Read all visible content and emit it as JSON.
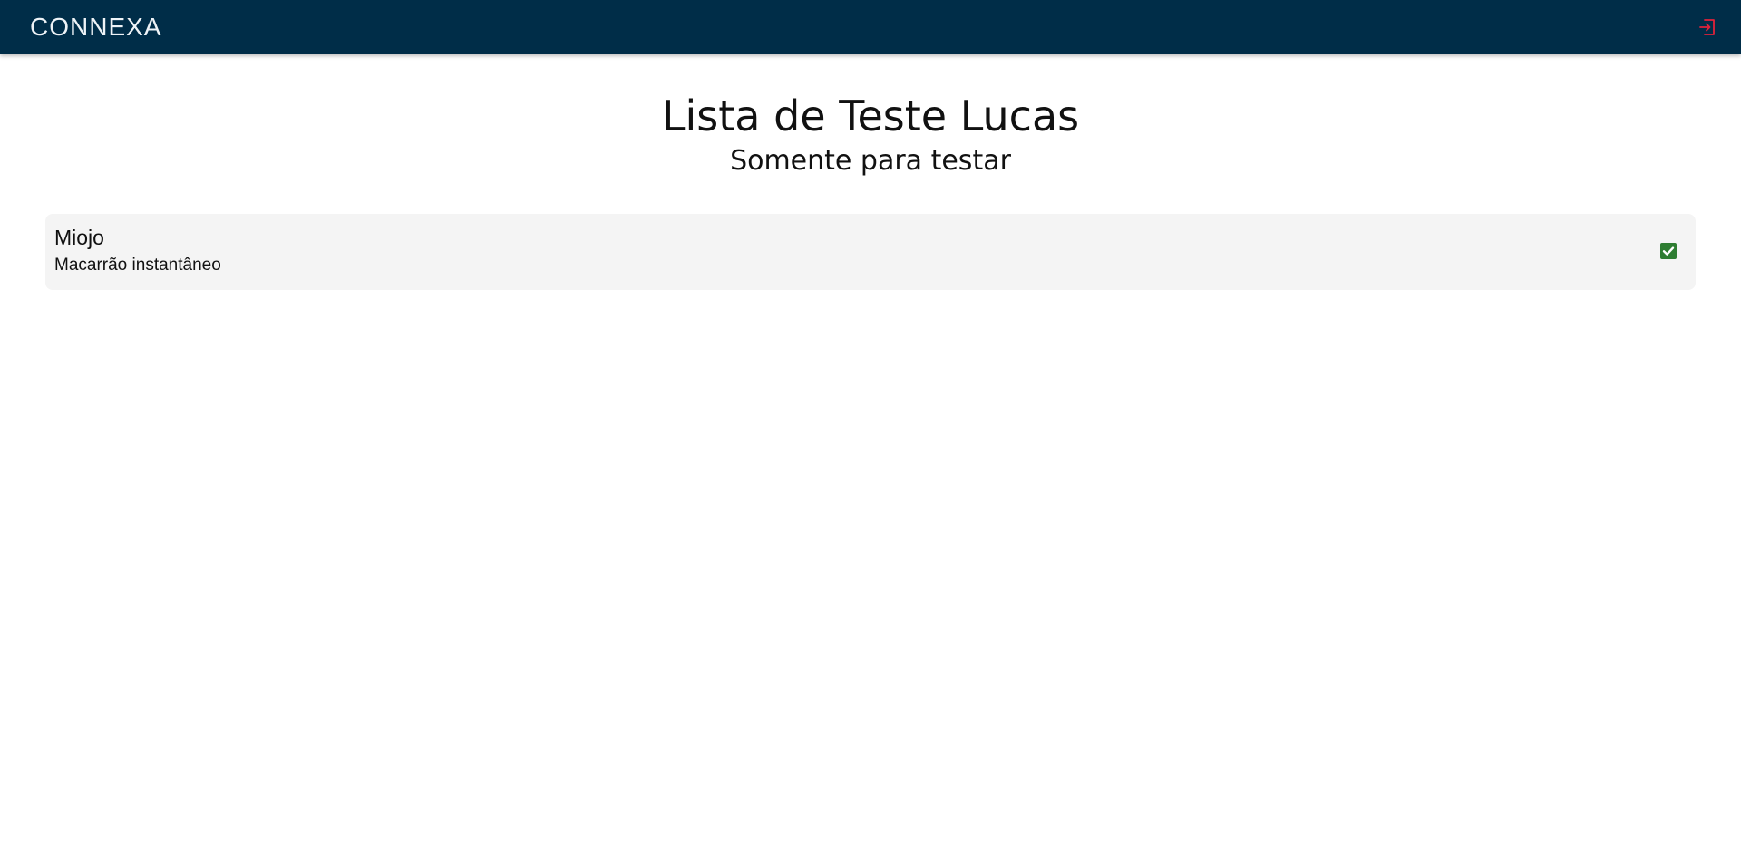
{
  "header": {
    "logo_text": "CONNEXA",
    "logout_icon": "logout-icon",
    "logout_color": "#e0223a",
    "bar_color": "#002d48"
  },
  "page": {
    "title": "Lista de Teste Lucas",
    "subtitle": "Somente para testar"
  },
  "list": {
    "items": [
      {
        "name": "Miojo",
        "description": "Macarrão instantâneo",
        "checked": true,
        "check_color": "#2e7d32"
      }
    ]
  }
}
